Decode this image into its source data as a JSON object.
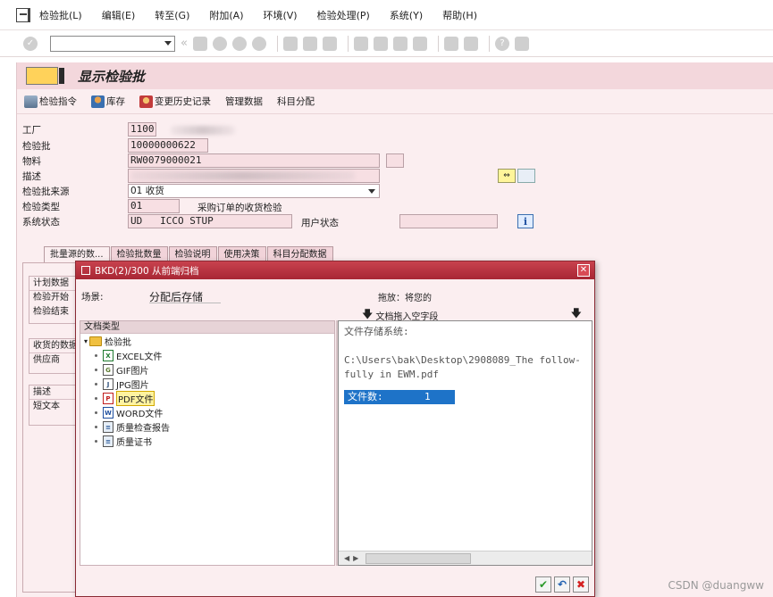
{
  "menubar": {
    "items": [
      "检验批(L)",
      "编辑(E)",
      "转至(G)",
      "附加(A)",
      "环境(V)",
      "检验处理(P)",
      "系统(Y)",
      "帮助(H)"
    ]
  },
  "toolbar": {
    "command_value": ""
  },
  "page": {
    "title": "显示检验批"
  },
  "app_toolbar": {
    "buttons": [
      "检验指令",
      "库存",
      "变更历史记录",
      "管理数据",
      "科目分配"
    ]
  },
  "form": {
    "plant_label": "工厂",
    "plant_value": "1100",
    "lot_label": "检验批",
    "lot_value": "10000000622",
    "material_label": "物料",
    "material_value": "RW0079000021",
    "desc_label": "描述",
    "origin_label": "检验批来源",
    "origin_value": "01 收货",
    "type_label": "检验类型",
    "type_value": "01",
    "type_desc": "采购订单的收货检验",
    "status_label": "系统状态",
    "status_value": "UD   ICCO STUP",
    "user_status_label": "用户状态"
  },
  "tabs": [
    "批量源的数...",
    "检验批数量",
    "检验说明",
    "使用决策",
    "科目分配数据"
  ],
  "groups": {
    "plan": {
      "header": "计划数据",
      "rows": [
        "检验开始",
        "检验结束"
      ]
    },
    "receipt": {
      "header": "收货的数据",
      "rows": [
        "供应商"
      ]
    },
    "desc": {
      "header": "描述",
      "rows": [
        "短文本"
      ]
    }
  },
  "dialog": {
    "title": "BKD(2)/300 从前端归档",
    "scene_label": "场景:",
    "scene_value": "分配后存储",
    "drag_hint": "拖放：将您的",
    "drop_hint": "文档拖入空字段",
    "tree_header": "文档类型",
    "tree_root": "检验批",
    "tree_items": [
      {
        "icon": "excel-icon",
        "label": "EXCEL文件"
      },
      {
        "icon": "gif-icon",
        "label": "GIF图片"
      },
      {
        "icon": "jpg-icon",
        "label": "JPG图片"
      },
      {
        "icon": "pdf-icon",
        "label": "PDF文件"
      },
      {
        "icon": "word-icon",
        "label": "WORD文件"
      },
      {
        "icon": "report-icon",
        "label": "质量检查报告"
      },
      {
        "icon": "certificate-icon",
        "label": "质量证书"
      }
    ],
    "store_title": "文件存储系统:",
    "store_path_1": "C:\\Users\\bak\\Desktop\\2908089_The follow-",
    "store_path_2": "fully in EWM.pdf",
    "store_count": "文件数:       1"
  },
  "watermark": "CSDN @duangww"
}
